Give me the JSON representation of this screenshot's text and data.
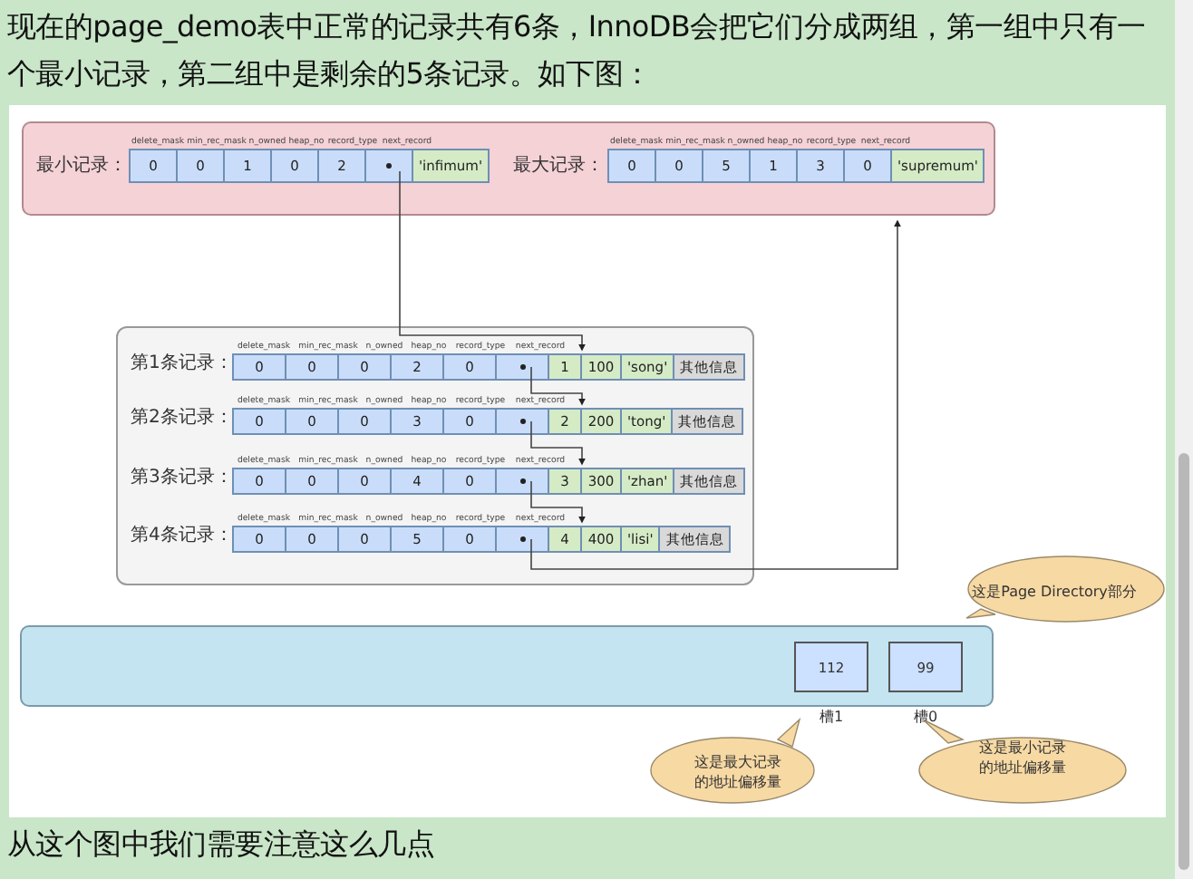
{
  "intro": "现在的page_demo表中正常的记录共有6条，InnoDB会把它们分成两组，第一组中只有一个最小记录，第二组中是剩余的5条记录。如下图：",
  "figure": {
    "special_records": [
      {
        "label": "最小记录：",
        "headers": [
          "delete_mask",
          "min_rec_mask",
          "n_owned",
          "heap_no",
          "record_type",
          "next_record"
        ],
        "values": [
          "0",
          "0",
          "1",
          "0",
          "2"
        ],
        "pointer": true,
        "name": "'infimum'"
      },
      {
        "label": "最大记录：",
        "headers": [
          "delete_mask",
          "min_rec_mask",
          "n_owned",
          "heap_no",
          "record_type",
          "next_record"
        ],
        "values": [
          "0",
          "0",
          "5",
          "1",
          "3",
          "0"
        ],
        "pointer": false,
        "name": "'supremum'"
      }
    ],
    "records": [
      {
        "label": "第1条记录：",
        "headers": [
          "delete_mask",
          "min_rec_mask",
          "n_owned",
          "heap_no",
          "record_type",
          "next_record"
        ],
        "values": [
          "0",
          "0",
          "0",
          "2",
          "0"
        ],
        "pointer": true,
        "data": [
          {
            "kind": "column",
            "text": "1"
          },
          {
            "kind": "column",
            "text": "100"
          },
          {
            "kind": "column",
            "text": "'song'"
          },
          {
            "kind": "other",
            "text": "其他信息"
          }
        ]
      },
      {
        "label": "第2条记录：",
        "headers": [
          "delete_mask",
          "min_rec_mask",
          "n_owned",
          "heap_no",
          "record_type",
          "next_record"
        ],
        "values": [
          "0",
          "0",
          "0",
          "3",
          "0"
        ],
        "pointer": true,
        "data": [
          {
            "kind": "column",
            "text": "2"
          },
          {
            "kind": "column",
            "text": "200"
          },
          {
            "kind": "column",
            "text": "'tong'"
          },
          {
            "kind": "other",
            "text": "其他信息"
          }
        ]
      },
      {
        "label": "第3条记录：",
        "headers": [
          "delete_mask",
          "min_rec_mask",
          "n_owned",
          "heap_no",
          "record_type",
          "next_record"
        ],
        "values": [
          "0",
          "0",
          "0",
          "4",
          "0"
        ],
        "pointer": true,
        "data": [
          {
            "kind": "column",
            "text": "3"
          },
          {
            "kind": "column",
            "text": "300"
          },
          {
            "kind": "column",
            "text": "'zhan'"
          },
          {
            "kind": "other",
            "text": "其他信息"
          }
        ]
      },
      {
        "label": "第4条记录：",
        "headers": [
          "delete_mask",
          "min_rec_mask",
          "n_owned",
          "heap_no",
          "record_type",
          "next_record"
        ],
        "values": [
          "0",
          "0",
          "0",
          "5",
          "0"
        ],
        "pointer": true,
        "data": [
          {
            "kind": "column",
            "text": "4"
          },
          {
            "kind": "column",
            "text": "400"
          },
          {
            "kind": "column",
            "text": "'lisi'"
          },
          {
            "kind": "other",
            "text": "其他信息"
          }
        ]
      }
    ],
    "slots": [
      {
        "value": "112",
        "label": "槽1"
      },
      {
        "value": "99",
        "label": "槽0"
      }
    ],
    "callouts": [
      {
        "lines": [
          "这是Page Directory部分"
        ]
      },
      {
        "lines": [
          "这是最大记录",
          "的地址偏移量"
        ]
      },
      {
        "lines": [
          "这是最小记录",
          "的地址偏移量"
        ]
      }
    ]
  },
  "outro": "从这个图中我们需要注意这么几点"
}
